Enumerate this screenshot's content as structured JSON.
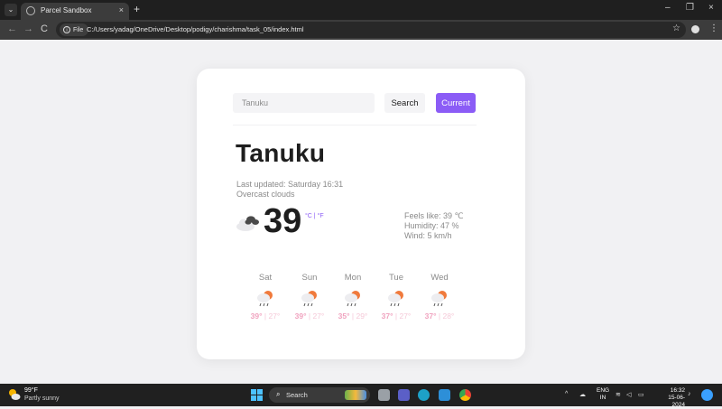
{
  "browser": {
    "tab_title": "Parcel Sandbox",
    "tab_close": "×",
    "new_tab": "+",
    "tab_list": "⌄",
    "nav_back": "←",
    "nav_forward": "→",
    "nav_reload": "C",
    "site_info_label": "File",
    "url": "C:/Users/yadag/OneDrive/Desktop/podigy/charishma/task_05/index.html",
    "bookmark_icon": "star-icon",
    "win_minimize": "–",
    "win_restore": "❐",
    "win_close": "×"
  },
  "app": {
    "search": {
      "placeholder": "Tanuku",
      "button_label": "Search",
      "current_label": "Current"
    },
    "city": "Tanuku",
    "last_updated": "Last updated: Saturday 16:31",
    "condition": "Overcast clouds",
    "temperature": "39",
    "units": "°C | °F",
    "feels_like": "Feels like: 39 ℃",
    "humidity": "Humidity: 47 %",
    "wind": "Wind: 5 km/h",
    "forecast": [
      {
        "day": "Sat",
        "high": "39°",
        "low": "27°"
      },
      {
        "day": "Sun",
        "high": "39°",
        "low": "27°"
      },
      {
        "day": "Mon",
        "high": "35°",
        "low": "29°"
      },
      {
        "day": "Tue",
        "high": "37°",
        "low": "27°"
      },
      {
        "day": "Wed",
        "high": "37°",
        "low": "28°"
      }
    ],
    "accent_color": "#8b5cf6"
  },
  "taskbar": {
    "weather_temp": "99°F",
    "weather_desc": "Partly sunny",
    "search_label": "Search",
    "lang_line1": "ENG",
    "lang_line2": "IN",
    "time": "16:32",
    "date": "15-06-2024"
  }
}
